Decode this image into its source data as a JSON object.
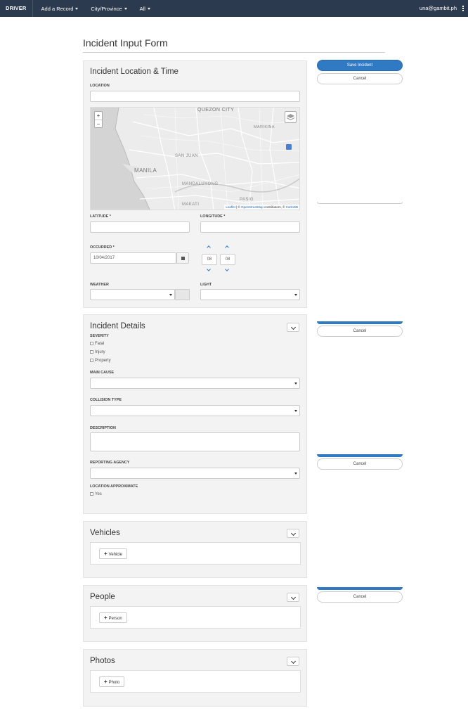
{
  "navbar": {
    "brand": "DRIVER",
    "items": [
      {
        "label": "Add a Record"
      },
      {
        "label": "City/Province"
      },
      {
        "label": "All"
      }
    ],
    "user": "una@gambit.ph"
  },
  "page_title": "Incident Input Form",
  "actions": {
    "save_label": "Save Incident",
    "cancel_label": "Cancel"
  },
  "location_panel": {
    "title": "Incident Location & Time",
    "location_label": "LOCATION",
    "location_value": "",
    "latitude_label": "LATITUDE *",
    "longitude_label": "LONGITUDE *",
    "occurred_label": "OCCURRED *",
    "occurred_date": "10/04/2017",
    "hour": "08",
    "minute": "08",
    "weather_label": "WEATHER",
    "light_label": "LIGHT"
  },
  "map": {
    "labels": {
      "quezon_city": "QUEZON CITY",
      "manila": "MANILA",
      "marikina": "MARIKINA",
      "san_juan": "SAN JUAN",
      "mandaluyong": "MANDALUYONG",
      "makati": "MAKATI",
      "pasig": "PASIG"
    },
    "zoom_in": "+",
    "zoom_out": "−",
    "attribution_leaflet": "Leaflet",
    "attribution_osm": "OpenStreetMap",
    "attribution_mid": " contributors, © ",
    "attribution_carto": "CartoDB",
    "attribution_sep": " | © "
  },
  "details_panel": {
    "title": "Incident Details",
    "severity_label": "SEVERITY",
    "severity_options": [
      "Fatal",
      "Injury",
      "Property"
    ],
    "main_cause_label": "MAIN CAUSE",
    "collision_type_label": "COLLISION TYPE",
    "description_label": "DESCRIPTION",
    "reporting_agency_label": "REPORTING AGENCY",
    "location_approx_label": "LOCATION APPROXIMATE",
    "location_approx_option": "Yes"
  },
  "vehicles_panel": {
    "title": "Vehicles",
    "add_label": "Vehicle"
  },
  "people_panel": {
    "title": "People",
    "add_label": "Person"
  },
  "photos_panel": {
    "title": "Photos",
    "add_label": "Photo"
  },
  "colors": {
    "navbar": "#2b3a4e",
    "primary": "#3079c3"
  }
}
